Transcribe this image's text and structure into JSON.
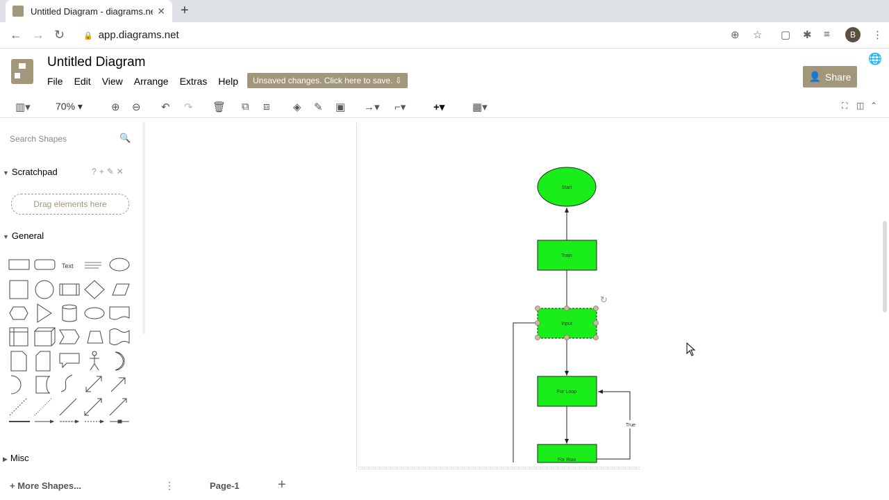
{
  "browser": {
    "tab_title": "Untitled Diagram - diagrams.net",
    "url": "app.diagrams.net"
  },
  "header": {
    "doc_title": "Untitled Diagram",
    "menus": [
      "File",
      "Edit",
      "View",
      "Arrange",
      "Extras",
      "Help"
    ],
    "unsaved_label": "Unsaved changes. Click here to save.",
    "share_label": "Share"
  },
  "toolbar": {
    "zoom": "70%"
  },
  "sidebar": {
    "search_placeholder": "Search Shapes",
    "scratchpad_label": "Scratchpad",
    "scratch_help": "?",
    "dropzone_label": "Drag elements here",
    "general_label": "General",
    "text_shape_label": "Text",
    "textbox_label": "Heading",
    "misc_label": "Misc",
    "more_shapes_label": "More Shapes..."
  },
  "footer": {
    "page_tab": "Page-1"
  },
  "diagram": {
    "start_label": "Start",
    "node2_label": "Train",
    "node3_label": "Input",
    "node4_label": "For Loop",
    "node5_label": "For Row",
    "loop_edge_label": "True"
  },
  "colors": {
    "accent": "#a2977a",
    "node_fill": "#1aee1a"
  }
}
